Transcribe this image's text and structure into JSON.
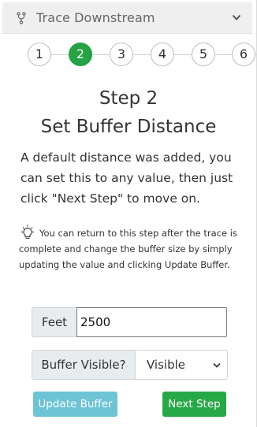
{
  "header": {
    "title": "Trace Downstream",
    "icon": "fork-icon",
    "toggle_icon": "chevron-down-icon"
  },
  "stepper": {
    "steps": [
      "1",
      "2",
      "3",
      "4",
      "5",
      "6"
    ],
    "active_step": "2",
    "active_color": "#25a243"
  },
  "content": {
    "step_title": "Step 2",
    "heading": "Set Buffer Distance",
    "description": "A default distance was added, you can set this to any value, then just click \"Next Step\" to move on.",
    "tip_icon": "lightbulb-icon",
    "tip": "You can return to this step after the trace is complete and change the buffer size by simply updating the value and clicking Update Buffer."
  },
  "form": {
    "distance_unit_label": "Feet",
    "distance_value": "2500",
    "visible_label": "Buffer Visible?",
    "visible_value": "Visible"
  },
  "buttons": {
    "update_label": "Update Buffer",
    "update_color": "#6cc4d4",
    "next_label": "Next Step",
    "next_color": "#27a846"
  }
}
